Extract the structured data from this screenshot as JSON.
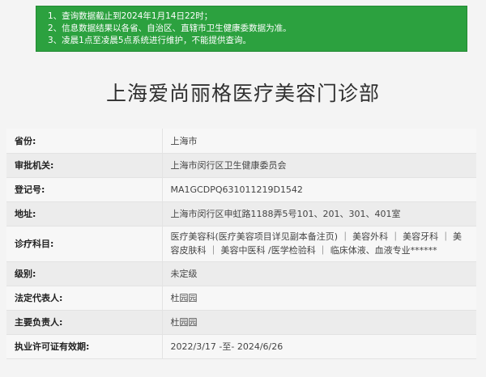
{
  "notice": {
    "lines": [
      "1、查询数据截止到2024年1月14日22时；",
      "2、信息数据结果以各省、自治区、直辖市卫生健康委数据为准。",
      "3、凌晨1点至凌晨5点系统进行维护，不能提供查询。"
    ]
  },
  "title": "上海爱尚丽格医疗美容门诊部",
  "rows": [
    {
      "label": "省份:",
      "value": "上海市"
    },
    {
      "label": "审批机关:",
      "value": "上海市闵行区卫生健康委员会"
    },
    {
      "label": "登记号:",
      "value": "MA1GCDPQ631011219D1542"
    },
    {
      "label": "地址:",
      "value": "上海市闵行区申虹路1188弄5号101、201、301、401室"
    },
    {
      "label": "诊疗科目:",
      "value": "医疗美容科(医疗美容项目详见副本备注页) ｜ 美容外科 ｜ 美容牙科 ｜ 美容皮肤科 ｜ 美容中医科 /医学检验科 ｜ 临床体液、血液专业******"
    },
    {
      "label": "级别:",
      "value": "未定级"
    },
    {
      "label": "法定代表人:",
      "value": "杜园园"
    },
    {
      "label": "主要负责人:",
      "value": "杜园园"
    },
    {
      "label": "执业许可证有效期:",
      "value": "2022/3/17 -至- 2024/6/26"
    }
  ],
  "colors": {
    "notice_bg": "#2ca13f",
    "page_bg": "#f4f4f4"
  }
}
